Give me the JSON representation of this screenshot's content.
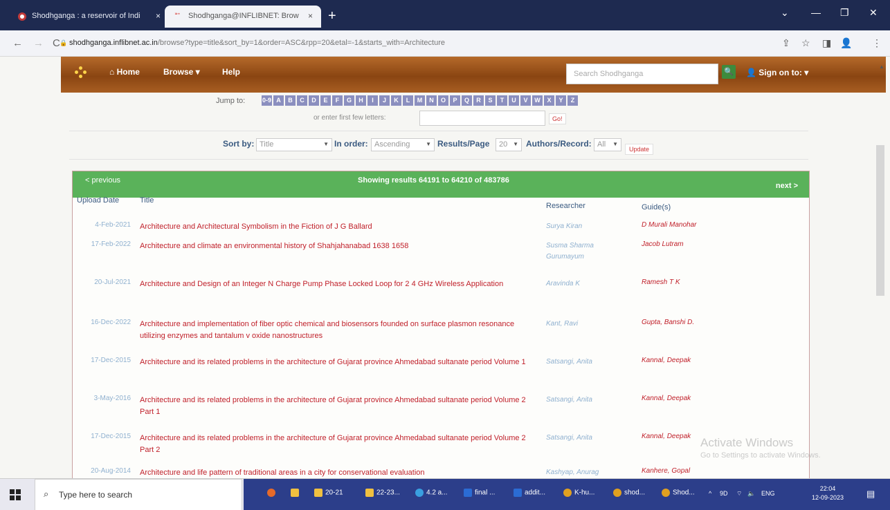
{
  "browser": {
    "tabs": [
      {
        "label": "Shodhganga : a reservoir of Indi"
      },
      {
        "label": "Shodhganga@INFLIBNET: Brow"
      }
    ],
    "tab_close": "×",
    "new_tab": "+",
    "url_host": "shodhganga.inflibnet.ac.in",
    "url_path": "/browse?type=title&sort_by=1&order=ASC&rpp=20&etal=-1&starts_with=Architecture",
    "nav": {
      "back": "←",
      "forward": "→",
      "reload": "C"
    },
    "window_controls": {
      "chevron": "⌄",
      "minimize": "—",
      "restore": "❐",
      "close": "✕"
    }
  },
  "header": {
    "home": "Home",
    "browse": "Browse ▾",
    "help": "Help",
    "search_placeholder": "Search Shodhganga",
    "search_button": "🔍",
    "sign_on": "Sign on to: ▾"
  },
  "jump": {
    "label": "Jump to:",
    "letters": [
      "0-9",
      "A",
      "B",
      "C",
      "D",
      "E",
      "F",
      "G",
      "H",
      "I",
      "J",
      "K",
      "L",
      "M",
      "N",
      "O",
      "P",
      "Q",
      "R",
      "S",
      "T",
      "U",
      "V",
      "W",
      "X",
      "Y",
      "Z"
    ],
    "enter_label": "or enter first few letters:",
    "go_label": "Go!"
  },
  "sort": {
    "sort_by_label": "Sort by:",
    "sort_by_value": "Title",
    "order_label": "In order:",
    "order_value": "Ascending",
    "rpp_label": "Results/Page",
    "rpp_value": "20",
    "authors_label": "Authors/Record:",
    "authors_value": "All",
    "update_label": "Update"
  },
  "results": {
    "prev": "< previous",
    "showing": "Showing results 64191 to 64210 of 483786",
    "next": "next >",
    "columns": {
      "date": "Upload Date",
      "title": "Title",
      "researcher": "Researcher",
      "guide": "Guide(s)"
    },
    "rows": [
      {
        "date": "4-Feb-2021",
        "title": "Architecture and Architectural Symbolism in the Fiction of J G Ballard",
        "researcher": "Surya Kiran",
        "guide": "D Murali Manohar"
      },
      {
        "date": "17-Feb-2022",
        "title": "Architecture and climate an environmental history of Shahjahanabad 1638 1658",
        "researcher": "Susma Sharma Gurumayum",
        "guide": "Jacob Lutram"
      },
      {
        "date": "20-Jul-2021",
        "title": "Architecture and Design of an Integer N Charge Pump Phase Locked Loop for 2 4 GHz Wireless Application",
        "researcher": "Aravinda K",
        "guide": "Ramesh T K"
      },
      {
        "date": "16-Dec-2022",
        "title": "Architecture and implementation of fiber optic chemical and biosensors founded on surface plasmon resonance utilizing enzymes and tantalum v oxide nanostructures",
        "researcher": "Kant, Ravi",
        "guide": "Gupta, Banshi D."
      },
      {
        "date": "17-Dec-2015",
        "title": "Architecture and its related problems in the architecture of Gujarat province Ahmedabad sultanate period Volume 1",
        "researcher": "Satsangi, Anita",
        "guide": "Kannal, Deepak"
      },
      {
        "date": "3-May-2016",
        "title": "Architecture and its related problems in the architecture of Gujarat province Ahmedabad sultanate period Volume 2 Part 1",
        "researcher": "Satsangi, Anita",
        "guide": "Kannal, Deepak"
      },
      {
        "date": "17-Dec-2015",
        "title": "Architecture and its related problems in the architecture of Gujarat province Ahmedabad sultanate period Volume 2 Part 2",
        "researcher": "Satsangi, Anita",
        "guide": "Kannal, Deepak"
      },
      {
        "date": "20-Aug-2014",
        "title": "Architecture and life pattern of traditional areas in a city for conservational evaluation",
        "researcher": "Kashyap, Anurag",
        "guide": "Kanhere, Gopal"
      }
    ]
  },
  "watermark": {
    "line1": "Activate Windows",
    "line2": "Go to Settings to activate Windows."
  },
  "taskbar": {
    "search_placeholder": "Type here to search",
    "items": [
      "20-21",
      "22-23...",
      "4.2 a...",
      "final ...",
      "addit...",
      "K-hu...",
      "shod...",
      "Shod..."
    ],
    "tray_lang": "ENG",
    "tray_temp": "9D",
    "time": "22:04",
    "date": "12-09-2023"
  },
  "colors": {
    "header": "#8a4512",
    "results_bar": "#5ab25a",
    "link": "#c0202a",
    "muted": "#8fb0cf"
  }
}
